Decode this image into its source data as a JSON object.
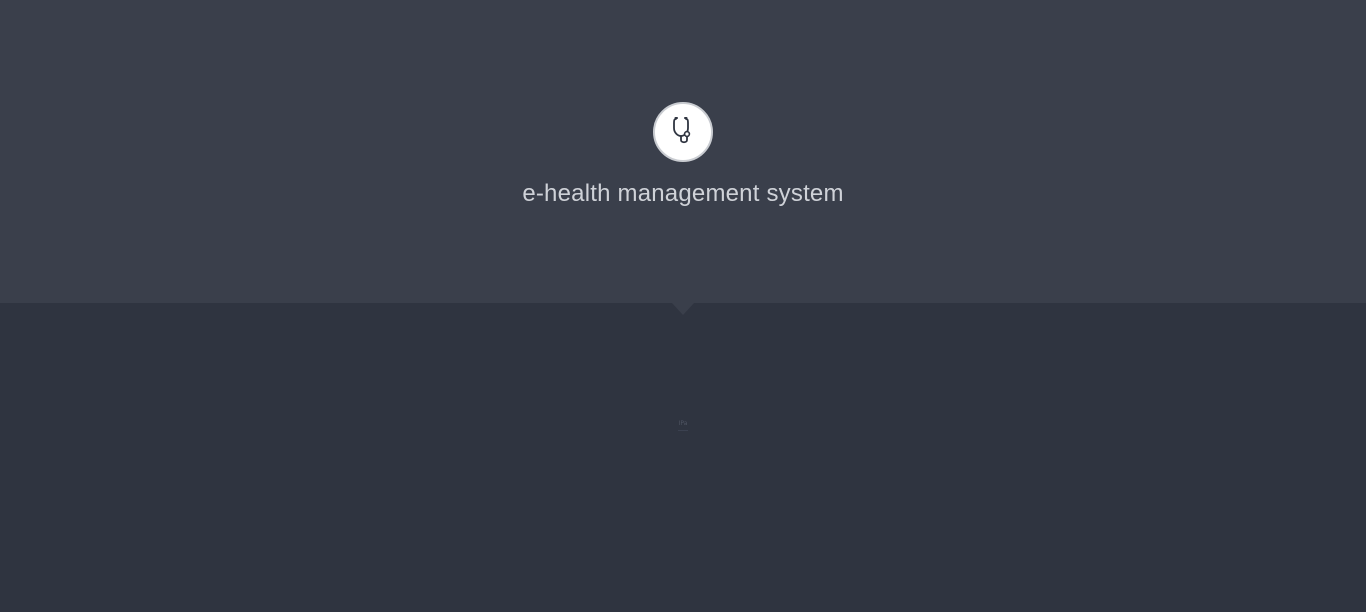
{
  "app": {
    "title": "e-health management system",
    "logo_icon": "stethoscope-icon"
  },
  "loader": {
    "text": "IPa"
  },
  "colors": {
    "header_bg": "#3a3f4b",
    "body_bg": "#2f3440",
    "title_text": "#cfd2d8",
    "logo_bg": "#ffffff"
  }
}
